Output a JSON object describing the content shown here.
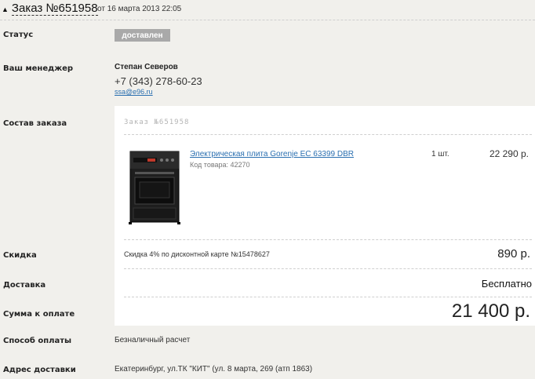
{
  "order": {
    "title": "Заказ №651958",
    "date": "от 16 марта 2013 22:05"
  },
  "status": {
    "label": "Статус",
    "value": "доставлен"
  },
  "manager": {
    "label": "Ваш менеджер",
    "name": "Степан Северов",
    "phone": "+7 (343) 278-60-23",
    "email": "ssa@e96.ru"
  },
  "composition": {
    "label": "Состав заказа",
    "panel_title": "Заказ №651958",
    "items": [
      {
        "name": "Электрическая плита Gorenje EC 63399 DBR",
        "code": "Код товара: 42270",
        "qty": "1 шт.",
        "price": "22 290 р."
      }
    ]
  },
  "discount": {
    "label": "Скидка",
    "text": "Скидка 4% по дисконтной карте №15478627",
    "amount": "890 р."
  },
  "delivery": {
    "label": "Доставка",
    "value": "Бесплатно"
  },
  "total": {
    "label": "Сумма к оплате",
    "value": "21 400 р."
  },
  "payment": {
    "label": "Способ оплаты",
    "value": "Безналичный расчет"
  },
  "address": {
    "label": "Адрес доставки",
    "value": "Екатеринбург, ул.ТК \"КИТ\" (ул. 8 марта, 269 (атп 1863)"
  }
}
